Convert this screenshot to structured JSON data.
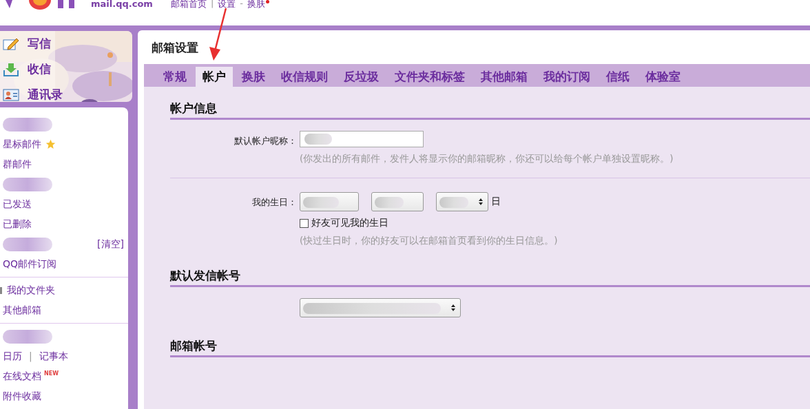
{
  "header": {
    "domain": "mail.qq.com",
    "nav": [
      {
        "kind": "link",
        "label": "邮箱首页"
      },
      {
        "kind": "sep",
        "label": "|"
      },
      {
        "kind": "link",
        "label": "设置"
      },
      {
        "kind": "sep",
        "label": "-"
      },
      {
        "kind": "link",
        "label": "换肤",
        "dot": true
      }
    ]
  },
  "sidebar": {
    "actions": [
      {
        "label": "写信",
        "kind": "compose"
      },
      {
        "label": "收信",
        "kind": "inbox"
      },
      {
        "label": "通讯录",
        "kind": "contacts"
      }
    ],
    "sections": [
      {
        "items": [
          {
            "kind": "redacted"
          },
          {
            "kind": "link",
            "label": "星标邮件",
            "starred": true
          },
          {
            "kind": "link",
            "label": "群邮件"
          },
          {
            "kind": "redacted"
          },
          {
            "kind": "link",
            "label": "已发送"
          },
          {
            "kind": "link",
            "label": "已删除"
          },
          {
            "kind": "redacted",
            "action": "[清空]"
          },
          {
            "kind": "link",
            "label": "QQ邮件订阅"
          }
        ]
      },
      {
        "items": [
          {
            "kind": "link",
            "label": "我的文件夹",
            "toggle": true
          },
          {
            "kind": "link",
            "label": "其他邮箱"
          }
        ]
      },
      {
        "items": [
          {
            "kind": "redacted"
          },
          {
            "kind": "pair",
            "labels": [
              "日历",
              "记事本"
            ],
            "sep": "|"
          },
          {
            "kind": "link",
            "label": "在线文档",
            "badge": "NEW"
          },
          {
            "kind": "link",
            "label": "附件收藏"
          }
        ]
      }
    ]
  },
  "settings": {
    "title": "邮箱设置",
    "tabs": [
      {
        "label": "常规",
        "selected": false
      },
      {
        "label": "帐户",
        "selected": true
      },
      {
        "label": "换肤",
        "selected": false
      },
      {
        "label": "收信规则",
        "selected": false
      },
      {
        "label": "反垃圾",
        "selected": false
      },
      {
        "label": "文件夹和标签",
        "selected": false
      },
      {
        "label": "其他邮箱",
        "selected": false
      },
      {
        "label": "我的订阅",
        "selected": false
      },
      {
        "label": "信纸",
        "selected": false
      },
      {
        "label": "体验室",
        "selected": false
      }
    ],
    "sections": [
      {
        "heading": "帐户信息",
        "rows": [
          {
            "kind": "text",
            "label": "默认帐户昵称：",
            "hint": "(你发出的所有邮件，发件人将显示你的邮箱昵称，你还可以给每个帐户单独设置昵称。)"
          },
          {
            "kind": "birthday",
            "label": "我的生日：",
            "day_unit": "日",
            "checkbox": {
              "label": "好友可见我的生日",
              "checked": false
            },
            "hint": "(快过生日时，你的好友可以在邮箱首页看到你的生日信息。)"
          }
        ]
      },
      {
        "heading": "默认发信帐号",
        "rows": [
          {
            "kind": "select"
          }
        ]
      },
      {
        "heading": "邮箱帐号"
      }
    ]
  }
}
